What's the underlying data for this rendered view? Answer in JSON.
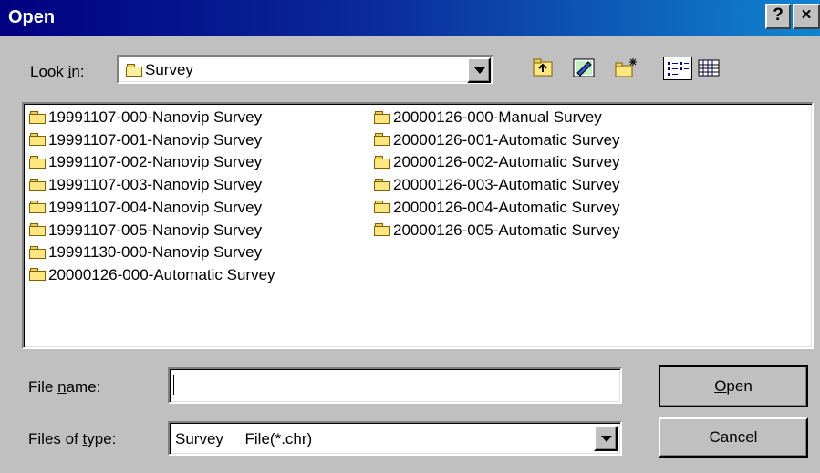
{
  "window": {
    "title": "Open",
    "help_glyph": "?",
    "close_glyph": "×"
  },
  "look_in": {
    "label_pre": "Look ",
    "label_key": "i",
    "label_post": "n:",
    "value": "Survey",
    "icon": "folder-open-icon"
  },
  "toolbar": {
    "icons": [
      "up-one-level-icon",
      "desktop-icon",
      "new-folder-icon",
      "list-view-icon",
      "details-view-icon"
    ]
  },
  "files": {
    "column1": [
      "19991107-000-Nanovip Survey",
      "19991107-001-Nanovip Survey",
      "19991107-002-Nanovip Survey",
      "19991107-003-Nanovip Survey",
      "19991107-004-Nanovip Survey",
      "19991107-005-Nanovip Survey",
      "19991130-000-Nanovip Survey",
      "20000126-000-Automatic Survey"
    ],
    "column2": [
      "20000126-000-Manual Survey",
      "20000126-001-Automatic Survey",
      "20000126-002-Automatic Survey",
      "20000126-003-Automatic Survey",
      "20000126-004-Automatic Survey",
      "20000126-005-Automatic Survey"
    ]
  },
  "file_name": {
    "label_pre": "File ",
    "label_key": "n",
    "label_post": "ame:",
    "value": ""
  },
  "file_type": {
    "label_pre": "Files of ",
    "label_key": "t",
    "label_post": "ype:",
    "value": "Survey     File(*.chr)"
  },
  "buttons": {
    "open_key": "O",
    "open_rest": "pen",
    "cancel": "Cancel"
  },
  "colors": {
    "title_start": "#000080",
    "title_end": "#1084d0",
    "face": "#c0c0c0"
  }
}
